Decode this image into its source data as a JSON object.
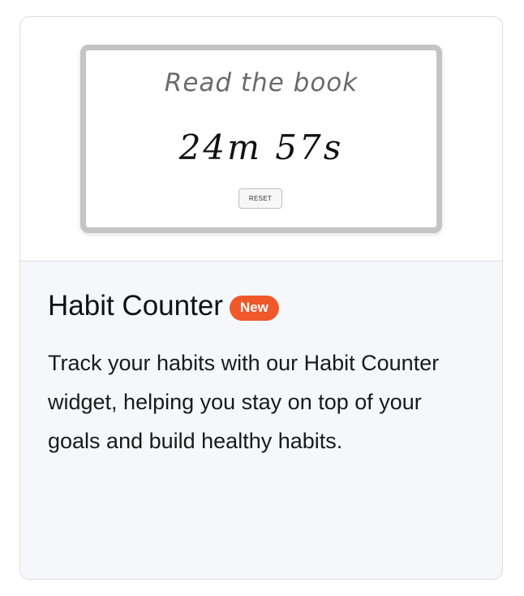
{
  "card": {
    "preview": {
      "widget_title": "Read the book",
      "timer": "24m 57s",
      "reset_label": "RESET"
    },
    "title": "Habit Counter",
    "badge": "New",
    "description": "Track your habits with our Habit Counter widget, helping you stay on top of your goals and build healthy habits."
  },
  "colors": {
    "badge_bg": "#f0582a",
    "card_body_bg": "#f6f7fb",
    "border": "#dcdde2"
  }
}
